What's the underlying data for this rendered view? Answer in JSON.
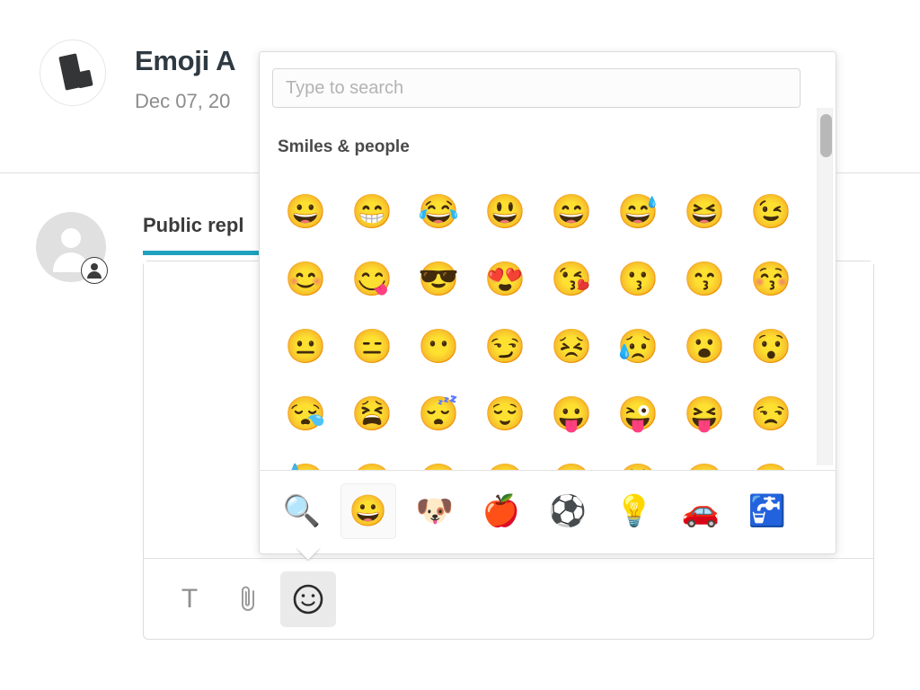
{
  "header": {
    "title": "Emoji A",
    "subtitle": "Dec 07, 20",
    "logo_icon": "brand-logo-icon"
  },
  "reply": {
    "tab_label": "Public repl",
    "accent_color": "#1fa2be",
    "avatar_icon": "user-avatar-icon",
    "avatar_badge_icon": "end-user-badge-icon",
    "toolbar": {
      "text_format_label": "T",
      "text_format_icon": "text-format-icon",
      "attach_icon": "paperclip-icon",
      "emoji_icon": "smiley-face-icon"
    }
  },
  "emoji_picker": {
    "search": {
      "placeholder": "Type to search",
      "value": ""
    },
    "category_title": "Smiles & people",
    "scrollbar": {
      "thumb_color": "#b8b8b8",
      "track_color": "#f3f3f3"
    },
    "emoji_rows": [
      [
        "😀",
        "😁",
        "😂",
        "😃",
        "😄",
        "😅",
        "😆",
        "😉"
      ],
      [
        "😊",
        "😋",
        "😎",
        "😍",
        "😘",
        "😗",
        "😙",
        "😚"
      ],
      [
        "😐",
        "😑",
        "😶",
        "😏",
        "😣",
        "😥",
        "😮",
        "😯"
      ],
      [
        "😪",
        "😫",
        "😴",
        "😌",
        "😛",
        "😜",
        "😝",
        "😒"
      ],
      [
        "😓",
        "😔",
        "😕",
        "🙃",
        "🙂",
        "😟",
        "🙁",
        "😖"
      ]
    ],
    "category_tabs": [
      {
        "icon": "🔍",
        "name": "search-category-tab",
        "selected": false
      },
      {
        "icon": "😀",
        "name": "smileys-category-tab",
        "selected": true
      },
      {
        "icon": "🐶",
        "name": "animals-category-tab",
        "selected": false
      },
      {
        "icon": "🍎",
        "name": "food-category-tab",
        "selected": false
      },
      {
        "icon": "⚽",
        "name": "activity-category-tab",
        "selected": false
      },
      {
        "icon": "💡",
        "name": "objects-category-tab",
        "selected": false
      },
      {
        "icon": "🚗",
        "name": "travel-category-tab",
        "selected": false
      },
      {
        "icon": "🚰",
        "name": "symbols-category-tab",
        "selected": false
      }
    ]
  }
}
